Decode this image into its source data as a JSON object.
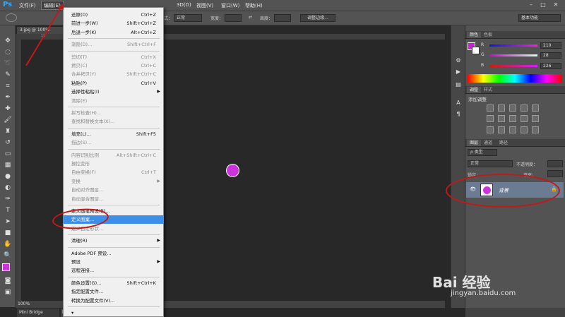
{
  "app": {
    "logo": "Ps"
  },
  "menubar": {
    "items": [
      "文件(F)",
      "编辑(E)",
      "图像(I)",
      "图层(L)",
      "文字(Y)",
      "选择(S)",
      "滤镜(T)",
      "3D(D)",
      "视图(V)",
      "窗口(W)",
      "帮助(H)"
    ],
    "window_controls": [
      "–",
      "□",
      "✕"
    ]
  },
  "optionsbar": {
    "style_label": "式：",
    "style_value": "正常",
    "width_label": "宽度：",
    "height_label": "高度：",
    "refine_edge_btn": "调整边缘...",
    "workspace": "基本功能"
  },
  "document": {
    "tab_title": "3.jpg @ 100%(RGB/8",
    "ruler_mark": "16",
    "zoom": "100%",
    "status_extra": "",
    "bottom_tab": "Mini Bridge",
    "bottom_tab2": "时间"
  },
  "edit_menu": {
    "items": [
      {
        "label": "还原(O)",
        "shortcut": "Ctrl+Z",
        "disabled": false
      },
      {
        "label": "前进一步(W)",
        "shortcut": "Shift+Ctrl+Z",
        "disabled": false
      },
      {
        "label": "后退一步(K)",
        "shortcut": "Alt+Ctrl+Z",
        "disabled": false
      },
      {
        "sep": true
      },
      {
        "label": "渐隐(D)...",
        "shortcut": "Shift+Ctrl+F",
        "disabled": true
      },
      {
        "sep": true
      },
      {
        "label": "剪切(T)",
        "shortcut": "Ctrl+X",
        "disabled": true
      },
      {
        "label": "拷贝(C)",
        "shortcut": "Ctrl+C",
        "disabled": true
      },
      {
        "label": "合并拷贝(Y)",
        "shortcut": "Shift+Ctrl+C",
        "disabled": true
      },
      {
        "label": "粘贴(P)",
        "shortcut": "Ctrl+V",
        "disabled": false
      },
      {
        "label": "选择性粘贴(I)",
        "shortcut": "",
        "arrow": true,
        "disabled": false
      },
      {
        "label": "清除(E)",
        "shortcut": "",
        "disabled": true
      },
      {
        "sep": true
      },
      {
        "label": "拼写检查(H)...",
        "shortcut": "",
        "disabled": true
      },
      {
        "label": "查找和替换文本(X)...",
        "shortcut": "",
        "disabled": true
      },
      {
        "sep": true
      },
      {
        "label": "填充(L)...",
        "shortcut": "Shift+F5",
        "disabled": false
      },
      {
        "label": "描边(S)...",
        "shortcut": "",
        "disabled": true
      },
      {
        "sep": true
      },
      {
        "label": "内容识别比例",
        "shortcut": "Alt+Shift+Ctrl+C",
        "disabled": true
      },
      {
        "label": "操控变形",
        "shortcut": "",
        "disabled": true
      },
      {
        "label": "自由变换(F)",
        "shortcut": "Ctrl+T",
        "disabled": true
      },
      {
        "label": "变换",
        "shortcut": "",
        "arrow": true,
        "disabled": true
      },
      {
        "label": "自动对齐图层...",
        "shortcut": "",
        "disabled": true
      },
      {
        "label": "自动混合图层...",
        "shortcut": "",
        "disabled": true
      },
      {
        "sep": true
      },
      {
        "label": "定义画笔预设(B)...",
        "shortcut": "",
        "disabled": false
      },
      {
        "label": "定义图案...",
        "shortcut": "",
        "disabled": false,
        "highlight": true
      },
      {
        "label": "定义自定形状...",
        "shortcut": "",
        "disabled": true
      },
      {
        "sep": true
      },
      {
        "label": "清理(R)",
        "shortcut": "",
        "arrow": true,
        "disabled": false
      },
      {
        "sep": true
      },
      {
        "label": "Adobe PDF 预设...",
        "shortcut": "",
        "disabled": false
      },
      {
        "label": "预设",
        "shortcut": "",
        "arrow": true,
        "disabled": false
      },
      {
        "label": "远程连接...",
        "shortcut": "",
        "disabled": false
      },
      {
        "sep": true
      },
      {
        "label": "颜色设置(G)...",
        "shortcut": "Shift+Ctrl+K",
        "disabled": false
      },
      {
        "label": "指定配置文件...",
        "shortcut": "",
        "disabled": false
      },
      {
        "label": "转换为配置文件(V)...",
        "shortcut": "",
        "disabled": false
      },
      {
        "sep": true
      },
      {
        "label": "▾",
        "shortcut": "",
        "disabled": false
      }
    ]
  },
  "color_panel": {
    "tabs": [
      "颜色",
      "色板"
    ],
    "r_label": "R",
    "g_label": "G",
    "b_label": "B",
    "r": "210",
    "g": "28",
    "b": "226",
    "swatch_color": "#d21ce2"
  },
  "adjust_panel": {
    "tabs": [
      "调整",
      "样式"
    ],
    "title": "添加调整"
  },
  "layers_panel": {
    "tabs": [
      "图层",
      "通道",
      "路径"
    ],
    "filter": "ρ 类型",
    "blend_mode": "正常",
    "opacity_label": "不透明度：",
    "lock_label": "锁定：",
    "fill_label": "填充：",
    "layer_name": "背景"
  },
  "colors": {
    "accent": "#3d8ee8",
    "magenta": "#cc33dd",
    "annotation": "#c41818"
  },
  "watermark": {
    "brand": "Bai 经验",
    "url": "jingyan.baidu.com"
  }
}
